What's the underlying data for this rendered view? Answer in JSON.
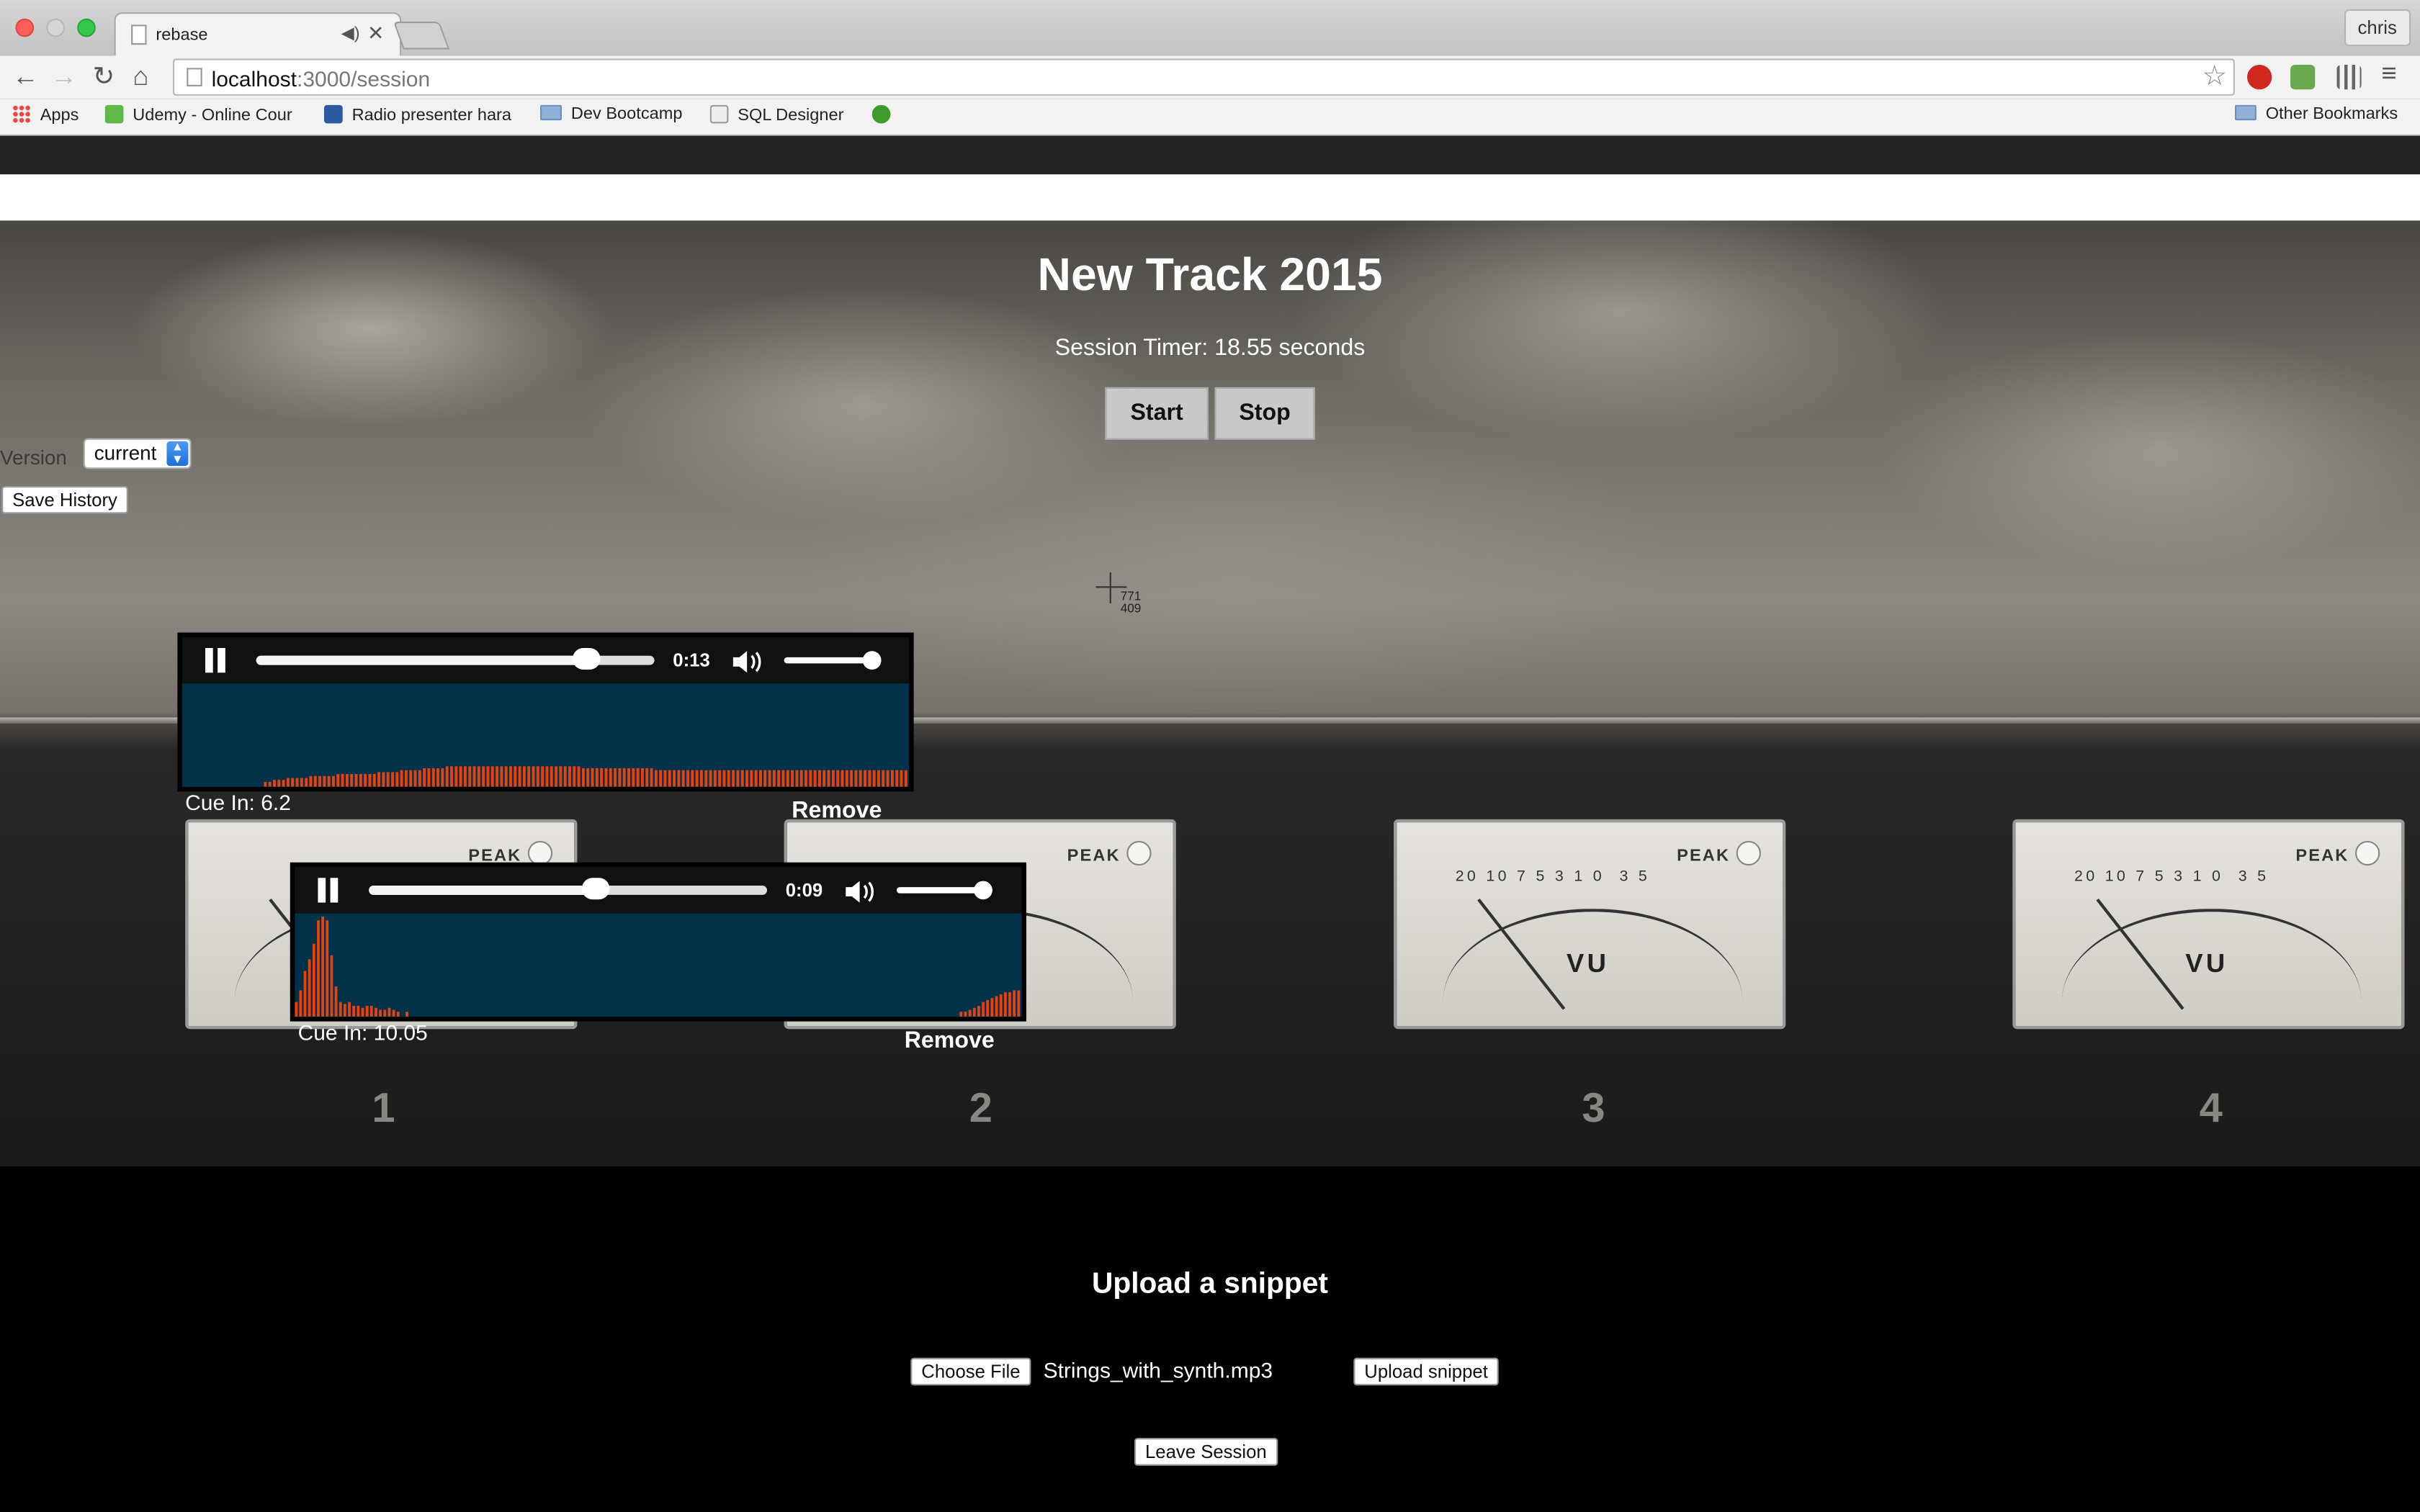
{
  "browser": {
    "tab_title": "rebase",
    "profile": "chris",
    "url_host": "localhost",
    "url_path": ":3000/session",
    "bookmarks": [
      "Apps",
      "Udemy - Online Cour",
      "Radio presenter hara",
      "Dev Bootcamp",
      "SQL Designer"
    ],
    "other_bookmarks": "Other Bookmarks"
  },
  "session": {
    "title": "New Track 2015",
    "timer": "Session Timer: 18.55 seconds",
    "start_label": "Start",
    "stop_label": "Stop",
    "version_label": "Version",
    "version_selected": "current",
    "save_history_label": "Save History",
    "cursor_x": "771",
    "cursor_y": "409"
  },
  "meters": [
    "1",
    "2",
    "3",
    "4"
  ],
  "players": [
    {
      "time": "0:13",
      "progress": 0.83,
      "volume": 0.92,
      "cue": "Cue In: 6.2",
      "remove": "Remove",
      "waveform": [
        0,
        0,
        0,
        0,
        0,
        0,
        0,
        0,
        0,
        0,
        0,
        0,
        0,
        0,
        0,
        0,
        0,
        0,
        1,
        1,
        2,
        2,
        2,
        3,
        3,
        3,
        3,
        3,
        4,
        4,
        4,
        4,
        4,
        4,
        5,
        5,
        5,
        5,
        5,
        5,
        5,
        5,
        5,
        6,
        6,
        6,
        6,
        6,
        7,
        7,
        7,
        7,
        7,
        8,
        8,
        8,
        8,
        8,
        9,
        9,
        9,
        9,
        9,
        9,
        9,
        9,
        9,
        9,
        9,
        9,
        9,
        9,
        9,
        9,
        9,
        9,
        9,
        9,
        9,
        9,
        9,
        9,
        9,
        9,
        9,
        9,
        9,
        9,
        8,
        8,
        8,
        8,
        8,
        8,
        8,
        8,
        8,
        8,
        8,
        8,
        8,
        8,
        8,
        8,
        7,
        7,
        7,
        7,
        7,
        7,
        7,
        7,
        7,
        7,
        7,
        7,
        7,
        7,
        7,
        7,
        7,
        7,
        7,
        7,
        7,
        7,
        7,
        7,
        7,
        7,
        7,
        7,
        7,
        7,
        7,
        7,
        7,
        7,
        7,
        7,
        7,
        7,
        7,
        7,
        7,
        7,
        7,
        7,
        7,
        7,
        7,
        7,
        7,
        7,
        7,
        7,
        7,
        7,
        7,
        7
      ]
    },
    {
      "time": "0:09",
      "progress": 0.57,
      "volume": 0.9,
      "cue": "Cue In: 10.05",
      "remove": "Remove",
      "waveform": [
        6,
        12,
        22,
        28,
        36,
        48,
        50,
        48,
        30,
        14,
        6,
        5,
        6,
        4,
        4,
        3,
        4,
        4,
        3,
        2,
        2,
        3,
        2,
        1,
        0,
        1,
        0,
        0,
        0,
        0,
        0,
        0,
        0,
        0,
        0,
        0,
        0,
        0,
        0,
        0,
        0,
        0,
        0,
        0,
        0,
        0,
        0,
        0,
        0,
        0,
        0,
        0,
        0,
        0,
        0,
        0,
        0,
        0,
        0,
        0,
        0,
        0,
        0,
        0,
        0,
        0,
        0,
        0,
        0,
        0,
        0,
        0,
        0,
        0,
        0,
        0,
        0,
        0,
        0,
        0,
        0,
        0,
        0,
        0,
        0,
        0,
        0,
        0,
        0,
        0,
        0,
        0,
        0,
        0,
        0,
        0,
        0,
        0,
        0,
        0,
        0,
        0,
        0,
        0,
        0,
        0,
        0,
        0,
        0,
        0,
        0,
        0,
        0,
        0,
        0,
        0,
        0,
        0,
        0,
        0,
        0,
        0,
        0,
        0,
        0,
        0,
        0,
        0,
        0,
        0,
        0,
        0,
        0,
        0,
        0,
        0,
        0,
        0,
        0,
        0,
        0,
        0,
        0,
        0,
        0,
        0,
        0,
        0,
        0,
        0,
        1,
        1,
        2,
        3,
        4,
        6,
        7,
        8,
        9,
        10,
        11,
        11,
        12,
        12
      ]
    }
  ],
  "upload": {
    "heading": "Upload a snippet",
    "choose_file_label": "Choose File",
    "file_name": "Strings_with_synth.mp3",
    "upload_label": "Upload snippet",
    "leave_label": "Leave Session"
  },
  "colors": {
    "waveform_bar": "#e8400f",
    "waveform_bg": "#003249",
    "accent_select": "#1e6fd8"
  }
}
